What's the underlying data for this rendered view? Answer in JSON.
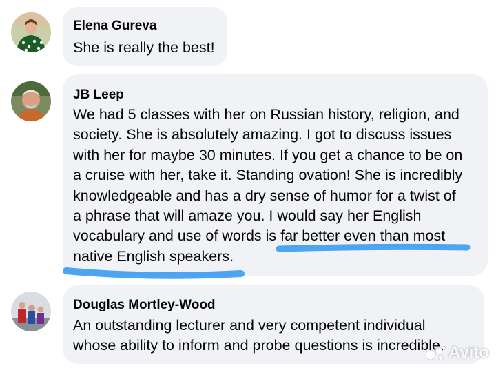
{
  "comments": [
    {
      "author": "Elena Gureva",
      "lines": [
        "She is really the best!"
      ]
    },
    {
      "author": "JB Leep",
      "lines": [
        "We had 5 classes with her on Russian history, religion, and",
        "society.  She is absolutely amazing.  I got to discuss issues",
        "with her for maybe 30 minutes.  If you get a chance to be on",
        "a cruise with her, take it.  Standing ovation!  She is incredibly",
        "knowledgeable and has a dry sense of humor for a twist of",
        "a phrase that will amaze you.  I would say her English",
        "vocabulary and use of words is far better even than most",
        "native English speakers."
      ]
    },
    {
      "author": "Douglas Mortley-Wood",
      "lines": [
        "An outstanding lecturer and very competent individual",
        "whose ability to inform and probe questions is incredible."
      ]
    }
  ],
  "watermark": "Avito",
  "colors": {
    "bubble": "#f0f2f5",
    "text": "#050505",
    "highlight": "#3b9bf0"
  }
}
